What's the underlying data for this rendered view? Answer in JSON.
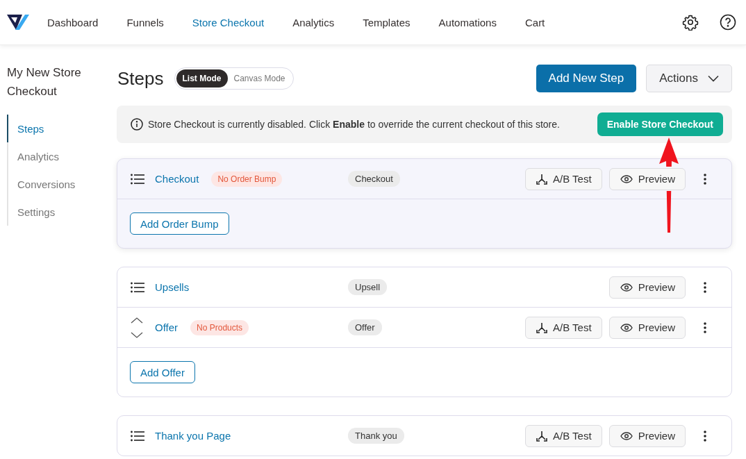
{
  "nav": {
    "items": [
      {
        "label": "Dashboard",
        "selected": false
      },
      {
        "label": "Funnels",
        "selected": false
      },
      {
        "label": "Store Checkout",
        "selected": true
      },
      {
        "label": "Analytics",
        "selected": false
      },
      {
        "label": "Templates",
        "selected": false
      },
      {
        "label": "Automations",
        "selected": false
      },
      {
        "label": "Cart",
        "selected": false
      }
    ]
  },
  "sidebar": {
    "title": "My New Store Checkout",
    "items": [
      {
        "label": "Steps",
        "selected": true
      },
      {
        "label": "Analytics",
        "selected": false
      },
      {
        "label": "Conversions",
        "selected": false
      },
      {
        "label": "Settings",
        "selected": false
      }
    ]
  },
  "header": {
    "title": "Steps",
    "modes": [
      {
        "label": "List Mode",
        "selected": true
      },
      {
        "label": "Canvas Mode",
        "selected": false
      }
    ],
    "add_button": "Add New Step",
    "actions_button": "Actions"
  },
  "notice": {
    "text": "Store Checkout is currently disabled. Click **Enable** to override the current checkout of this store.",
    "button": "Enable Store Checkout"
  },
  "groups": [
    {
      "highlighted": true,
      "steps": [
        {
          "kind": "list",
          "name": "Checkout",
          "badge": "No Order Bump",
          "type": "Checkout",
          "ab_test": "A/B Test",
          "preview": "Preview"
        }
      ],
      "add_button": "Add Order Bump"
    },
    {
      "highlighted": false,
      "steps": [
        {
          "kind": "list",
          "name": "Upsells",
          "type": "Upsell",
          "preview": "Preview"
        },
        {
          "kind": "arrows",
          "name": "Offer",
          "badge": "No Products",
          "type": "Offer",
          "ab_test": "A/B Test",
          "preview": "Preview"
        }
      ],
      "add_button": "Add Offer"
    },
    {
      "highlighted": false,
      "steps": [
        {
          "kind": "list",
          "name": "Thank you Page",
          "type": "Thank you",
          "ab_test": "A/B Test",
          "preview": "Preview"
        }
      ]
    }
  ]
}
